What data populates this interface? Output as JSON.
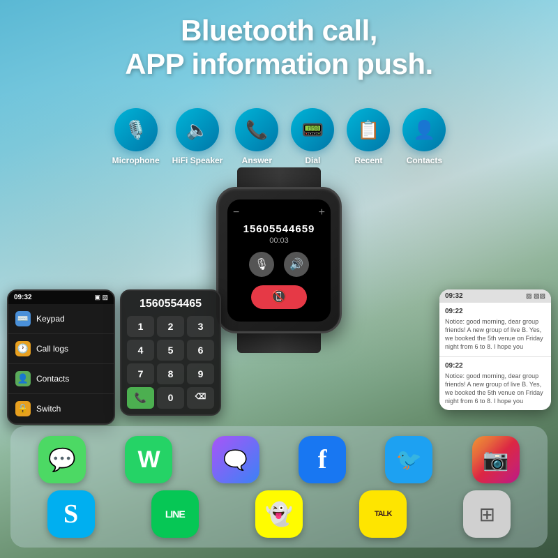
{
  "title": {
    "line1": "Bluetooth call,",
    "line2": "APP information push."
  },
  "features": [
    {
      "id": "microphone",
      "label": "Microphone",
      "icon": "🎙️"
    },
    {
      "id": "hifi-speaker",
      "label": "HiFi Speaker",
      "icon": "🔈"
    },
    {
      "id": "answer",
      "label": "Answer",
      "icon": "📞"
    },
    {
      "id": "dial",
      "label": "Dial",
      "icon": "📟"
    },
    {
      "id": "recent",
      "label": "Recent",
      "icon": "📋"
    },
    {
      "id": "contacts",
      "label": "Contacts",
      "icon": "👤"
    }
  ],
  "watch": {
    "call_number": "15605544659",
    "call_timer": "00:03"
  },
  "phone_menu": {
    "time": "09:32",
    "status_icons": "▣ ▨",
    "items": [
      {
        "id": "keypad",
        "label": "Keypad",
        "icon": "⌨️",
        "icon_color": "#4a90d9"
      },
      {
        "id": "call-logs",
        "label": "Call logs",
        "icon": "🕐",
        "icon_color": "#e8a020"
      },
      {
        "id": "contacts",
        "label": "Contacts",
        "icon": "👤",
        "icon_color": "#5aaa5a"
      },
      {
        "id": "switch",
        "label": "Switch",
        "icon": "🔒",
        "icon_color": "#e8a020"
      }
    ]
  },
  "dial_pad": {
    "display": "1560554465",
    "keys": [
      "1",
      "2",
      "3",
      "4",
      "5",
      "6",
      "7",
      "8",
      "9",
      "📞",
      "0",
      "⌫"
    ]
  },
  "apps": {
    "row1": [
      {
        "id": "messages",
        "label": "Messages",
        "bg": "#4cd964",
        "icon": "💬"
      },
      {
        "id": "whatsapp",
        "label": "WhatsApp",
        "bg": "#25d366",
        "icon": "📱"
      },
      {
        "id": "messenger",
        "label": "Messenger",
        "bg": "linear-gradient(135deg,#a855f7,#3b82f6)",
        "icon": "🗨️"
      },
      {
        "id": "facebook",
        "label": "Facebook",
        "bg": "#1877f2",
        "icon": "f"
      },
      {
        "id": "twitter",
        "label": "Twitter",
        "bg": "#1da1f2",
        "icon": "🐦"
      },
      {
        "id": "instagram",
        "label": "Instagram",
        "bg": "linear-gradient(135deg,#f09433,#e6683c,#dc2743,#cc2366,#bc1888)",
        "icon": "📷"
      }
    ],
    "row2": [
      {
        "id": "skype",
        "label": "Skype",
        "bg": "#00aff0",
        "icon": "S"
      },
      {
        "id": "line",
        "label": "Line",
        "bg": "#06c755",
        "icon": "LINE"
      },
      {
        "id": "snapchat",
        "label": "Snapchat",
        "bg": "#fffc00",
        "icon": "👻"
      },
      {
        "id": "kakao",
        "label": "KakaoTalk",
        "bg": "#fee500",
        "icon": "TALK"
      },
      {
        "id": "grid-app",
        "label": "Grid App",
        "bg": "#e0e0e0",
        "icon": "⊞"
      }
    ]
  },
  "notifications": {
    "time": "09:32",
    "battery": "▨▨",
    "items": [
      {
        "timestamp": "09:22",
        "text": "Notice: good morning, dear group friends! A new group of live B. Yes, we booked the 5th venue on Friday night from 6 to 8. I hope you"
      },
      {
        "timestamp": "09:22",
        "text": "Notice: good morning, dear group friends! A new group of live B. Yes, we booked the 5th venue on Friday night from 6 to 8. I hope you"
      }
    ]
  }
}
